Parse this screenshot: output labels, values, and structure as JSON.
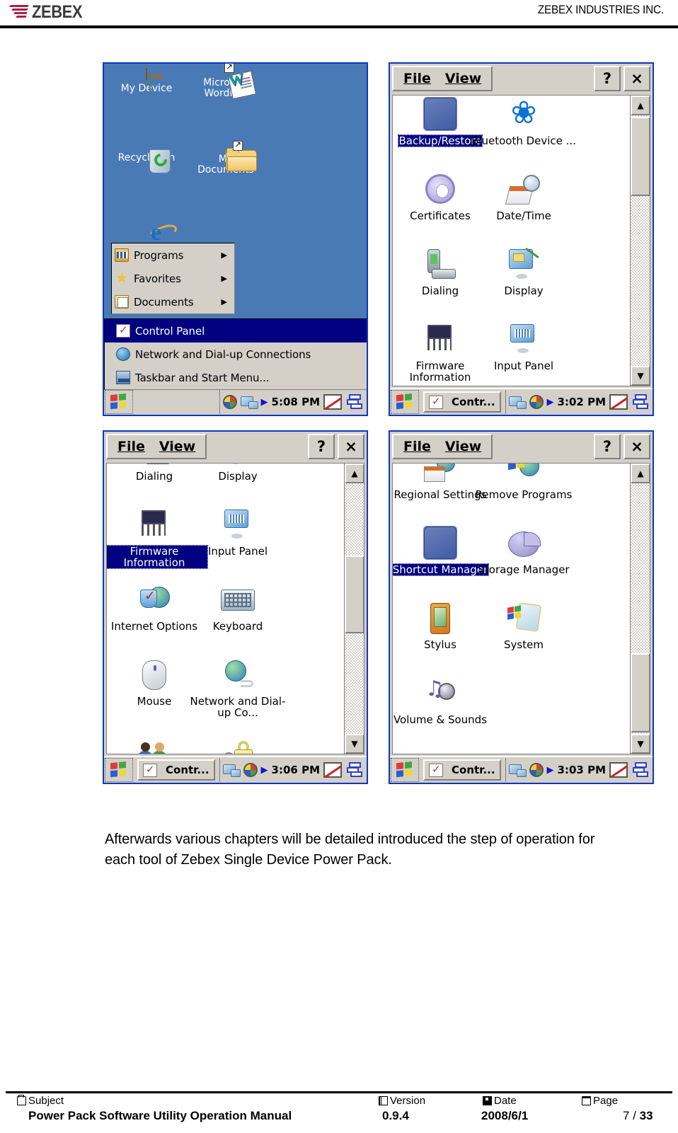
{
  "header": {
    "logo_text": "ZEBEX",
    "company": "ZEBEX INDUSTRIES INC."
  },
  "body_text": "Afterwards various chapters will be detailed introduced the step of operation for each tool of Zebex Single Device Power Pack.",
  "footer": {
    "subject_label": "Subject",
    "subject_value": "Power Pack Software Utility Operation Manual",
    "version_label": "Version",
    "version_value": "0.9.4",
    "date_label": "Date",
    "date_value": "2008/6/1",
    "page_label": "Page",
    "page_current": "7 / ",
    "page_total": "33"
  },
  "panel1": {
    "name": "windows-ce-desktop-with-start-menu",
    "desktop_icons": [
      {
        "name": "my-device",
        "label": "My Device",
        "icon": "pda-icon",
        "shortcut": false
      },
      {
        "name": "microsoft-wordpad",
        "label": "Microsoft WordPad",
        "icon": "wordpad-icon",
        "shortcut": true
      },
      {
        "name": "recycle-bin",
        "label": "Recycle Bin",
        "icon": "recycle-bin-icon",
        "shortcut": false
      },
      {
        "name": "my-documents",
        "label": "My Documents",
        "icon": "folder-icon",
        "shortcut": true
      },
      {
        "name": "internet-explorer",
        "label": "",
        "icon": "internet-explorer-icon",
        "shortcut": false
      }
    ],
    "start_menu_top": [
      {
        "label": "Programs",
        "icon": "programs-icon",
        "submenu": true
      },
      {
        "label": "Favorites",
        "icon": "favorites-star-icon",
        "submenu": true
      },
      {
        "label": "Documents",
        "icon": "documents-icon",
        "submenu": true
      }
    ],
    "start_menu_bottom": [
      {
        "label": "Control Panel",
        "icon": "control-panel-icon",
        "selected": true
      },
      {
        "label": "Network and Dial-up Connections",
        "icon": "network-globe-icon",
        "selected": false
      },
      {
        "label": "Taskbar and Start Menu...",
        "icon": "taskbar-icon",
        "selected": false
      }
    ],
    "taskbar": {
      "task_button": "",
      "clock": "5:08 PM"
    }
  },
  "panel2": {
    "name": "control-panel-page-1",
    "menu": {
      "file": "File",
      "view": "View"
    },
    "buttons": {
      "help": "?",
      "close": "×"
    },
    "items": [
      {
        "label": "Backup/Restore",
        "icon": "backup-restore-icon",
        "selected": true
      },
      {
        "label": "Bluetooth Device ...",
        "icon": "bluetooth-icon",
        "selected": false
      },
      {
        "label": "Certificates",
        "icon": "certificates-gear-icon",
        "selected": false
      },
      {
        "label": "Date/Time",
        "icon": "date-time-icon",
        "selected": false
      },
      {
        "label": "Dialing",
        "icon": "dialing-phone-icon",
        "selected": false
      },
      {
        "label": "Display",
        "icon": "display-monitor-icon",
        "selected": false
      },
      {
        "label": "Firmware Information",
        "icon": "firmware-chip-icon",
        "selected": false
      },
      {
        "label": "Input Panel",
        "icon": "input-panel-icon",
        "selected": false
      }
    ],
    "scrollbar": {
      "up": "▲",
      "down": "▼",
      "thumb_position": "top"
    },
    "taskbar": {
      "task_button": "Contr...",
      "clock": "3:02 PM"
    }
  },
  "panel3": {
    "name": "control-panel-page-2",
    "menu": {
      "file": "File",
      "view": "View"
    },
    "buttons": {
      "help": "?",
      "close": "×"
    },
    "items": [
      {
        "label": "Dialing",
        "icon": "dialing-phone-icon",
        "selected": false
      },
      {
        "label": "Display",
        "icon": "display-monitor-icon",
        "selected": false
      },
      {
        "label": "Firmware Information",
        "icon": "firmware-chip-icon",
        "selected": true
      },
      {
        "label": "Input Panel",
        "icon": "input-panel-icon",
        "selected": false
      },
      {
        "label": "Internet Options",
        "icon": "internet-options-icon",
        "selected": false
      },
      {
        "label": "Keyboard",
        "icon": "keyboard-icon",
        "selected": false
      },
      {
        "label": "Mouse",
        "icon": "mouse-icon",
        "selected": false
      },
      {
        "label": "Network and Dial-up Co...",
        "icon": "network-globe-icon",
        "selected": false
      },
      {
        "label": "",
        "icon": "owner-people-icon",
        "selected": false
      },
      {
        "label": "",
        "icon": "password-lock-icon",
        "selected": false
      }
    ],
    "scrollbar": {
      "up": "▲",
      "down": "▼",
      "thumb_position": "middle"
    },
    "taskbar": {
      "task_button": "Contr...",
      "clock": "3:06 PM"
    }
  },
  "panel4": {
    "name": "control-panel-page-3",
    "menu": {
      "file": "File",
      "view": "View"
    },
    "buttons": {
      "help": "?",
      "close": "×"
    },
    "items": [
      {
        "label": "Regional Settings",
        "icon": "regional-settings-icon",
        "selected": false
      },
      {
        "label": "Remove Programs",
        "icon": "remove-programs-icon",
        "selected": false
      },
      {
        "label": "Shortcut Manager",
        "icon": "shortcut-manager-icon",
        "selected": true
      },
      {
        "label": "Storage Manager",
        "icon": "storage-manager-icon",
        "selected": false
      },
      {
        "label": "Stylus",
        "icon": "stylus-icon",
        "selected": false
      },
      {
        "label": "System",
        "icon": "system-icon",
        "selected": false
      },
      {
        "label": "Volume & Sounds",
        "icon": "volume-sounds-icon",
        "selected": false
      }
    ],
    "scrollbar": {
      "up": "▲",
      "down": "▼",
      "thumb_position": "bottom"
    },
    "taskbar": {
      "task_button": "Contr...",
      "clock": "3:03 PM"
    }
  }
}
